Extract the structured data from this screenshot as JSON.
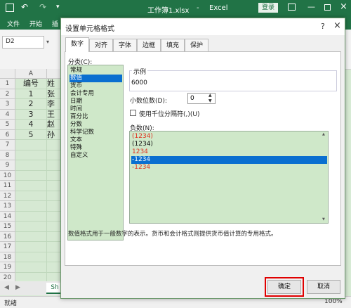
{
  "titlebar": {
    "filename": "工作簿1.xlsx",
    "separator": "-",
    "app": "Excel",
    "login": "登录",
    "bg": "#217346"
  },
  "ribbon": {
    "tabs": [
      "文件",
      "开始",
      "插"
    ]
  },
  "namebox": {
    "value": "D2"
  },
  "sheet": {
    "column_header": "A",
    "rows": [
      "1",
      "2",
      "3",
      "4",
      "5",
      "6",
      "7",
      "8",
      "9",
      "10",
      "11",
      "12",
      "13",
      "14",
      "15",
      "16",
      "17",
      "18",
      "19",
      "20"
    ],
    "col_a": [
      "编号",
      "1",
      "2",
      "3",
      "4",
      "5"
    ],
    "col_b": [
      "姓",
      "张",
      "李",
      "王",
      "赵",
      "孙"
    ],
    "sheet_tab": "Sh"
  },
  "status": {
    "ready": "就绪",
    "zoom": "100%"
  },
  "dialog": {
    "title": "设置单元格格式",
    "help": "?",
    "close": "×",
    "tabs": [
      "数字",
      "对齐",
      "字体",
      "边框",
      "填充",
      "保护"
    ],
    "active_tab": 0,
    "category_label": "分类(C):",
    "categories": [
      "常规",
      "数值",
      "货币",
      "会计专用",
      "日期",
      "时间",
      "百分比",
      "分数",
      "科学记数",
      "文本",
      "特殊",
      "自定义"
    ],
    "selected_category": 1,
    "sample_label": "示例",
    "sample_value": "6000",
    "decimals_label": "小数位数(D):",
    "decimals_value": "0",
    "thousands_label": "使用千位分隔符(,)(U)",
    "negative_label": "负数(N):",
    "negatives": [
      {
        "text": "(1234)",
        "color": "#e0301e"
      },
      {
        "text": "(1234)",
        "color": "#111111"
      },
      {
        "text": "1234",
        "color": "#e0301e"
      },
      {
        "text": "-1234",
        "color": "#111111"
      },
      {
        "text": "-1234",
        "color": "#e0301e"
      }
    ],
    "selected_negative": 3,
    "description": "数值格式用于一般数字的表示。货币和会计格式则提供货币值计算的专用格式。",
    "ok": "确定",
    "cancel": "取消",
    "highlight_color": "#e00000"
  }
}
